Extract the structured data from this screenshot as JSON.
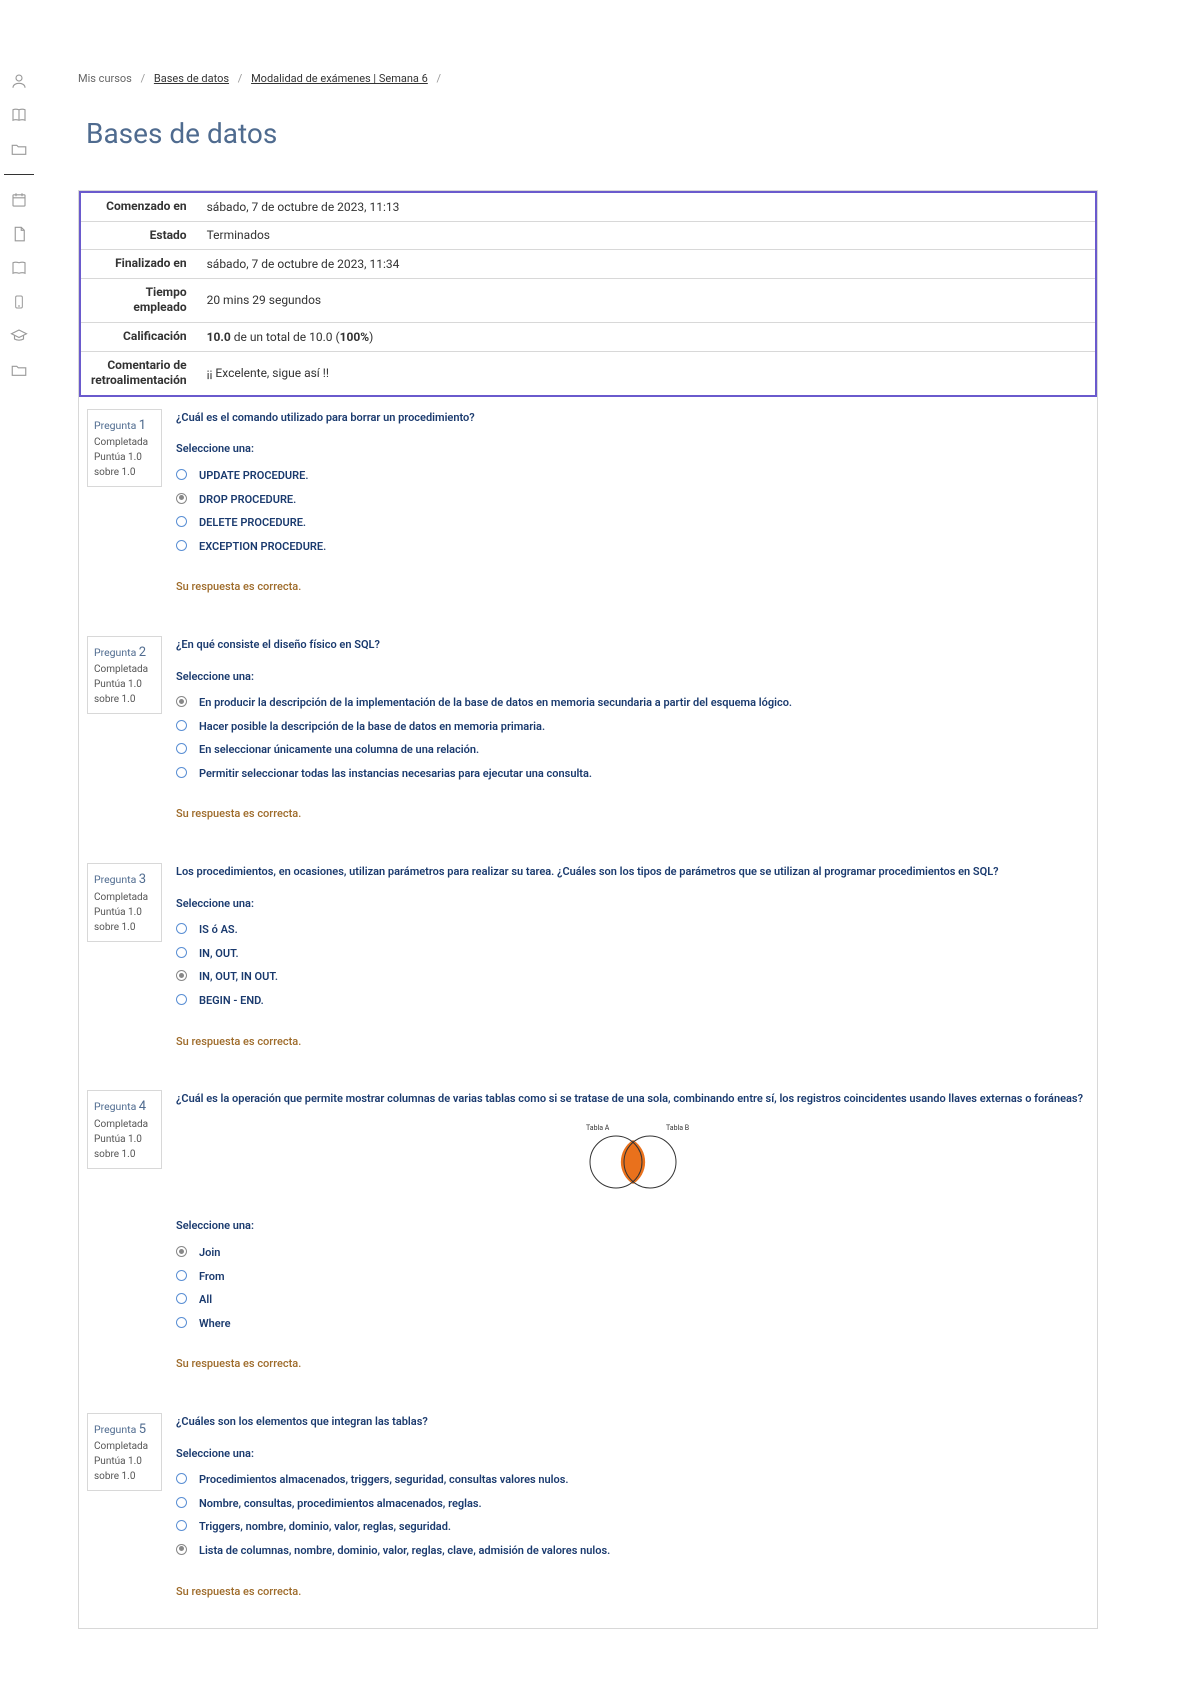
{
  "breadcrumb": {
    "item1": "Mis cursos",
    "item2": "Bases de datos",
    "item3": "Modalidad de exámenes | Semana 6"
  },
  "page_title": "Bases de datos",
  "summary": {
    "rows": [
      {
        "label": "Comenzado en",
        "value": "sábado, 7 de octubre de 2023, 11:13"
      },
      {
        "label": "Estado",
        "value": "Terminados"
      },
      {
        "label": "Finalizado en",
        "value": "sábado, 7 de octubre de 2023, 11:34"
      },
      {
        "label": "Tiempo empleado",
        "value": "20 mins 29 segundos"
      },
      {
        "label": "Calificación",
        "value_html": "10.0 de un total de 10.0 (100%)",
        "bold_prefix": "10.0",
        "rest": " de un total de 10.0 (",
        "bold_suffix": "100%",
        "rest2": ")"
      },
      {
        "label": "Comentario de retroalimentación",
        "value": "¡¡ Excelente, sigue así !!"
      }
    ]
  },
  "labels": {
    "question_prefix": "Pregunta",
    "completed": "Completada",
    "score_prefix": "Puntúa 1.0 sobre 1.0",
    "select_one": "Seleccione una:",
    "feedback_correct": "Su respuesta es correcta."
  },
  "venn": {
    "left_label": "Tabla A",
    "right_label": "Tabla B"
  },
  "questions": [
    {
      "num": "1",
      "text": "¿Cuál es el comando utilizado para borrar un procedimiento?",
      "options": [
        {
          "text": "UPDATE PROCEDURE.",
          "selected": false
        },
        {
          "text": "DROP PROCEDURE.",
          "selected": true
        },
        {
          "text": "DELETE PROCEDURE.",
          "selected": false
        },
        {
          "text": "EXCEPTION PROCEDURE.",
          "selected": false
        }
      ]
    },
    {
      "num": "2",
      "text": "¿En qué consiste el diseño físico en SQL?",
      "options": [
        {
          "text": "En producir la descripción de la implementación de la base de datos en memoria secundaria a partir del esquema lógico.",
          "selected": true
        },
        {
          "text": "Hacer posible la descripción de la base de datos en memoria primaria.",
          "selected": false
        },
        {
          "text": "En seleccionar únicamente una columna de una relación.",
          "selected": false
        },
        {
          "text": "Permitir seleccionar todas las instancias necesarias para ejecutar una consulta.",
          "selected": false
        }
      ]
    },
    {
      "num": "3",
      "text": "Los procedimientos, en ocasiones, utilizan parámetros para realizar su tarea. ¿Cuáles son los tipos de parámetros que se utilizan al programar procedimientos en SQL?",
      "options": [
        {
          "text": "IS ó AS.",
          "selected": false
        },
        {
          "text": "IN, OUT.",
          "selected": false
        },
        {
          "text": "IN, OUT, IN OUT.",
          "selected": true
        },
        {
          "text": "BEGIN - END.",
          "selected": false
        }
      ]
    },
    {
      "num": "4",
      "text": "¿Cuál es la operación que permite mostrar columnas de varias tablas como si se tratase de una sola, combinando entre sí, los registros coincidentes usando llaves externas o foráneas?",
      "has_venn": true,
      "options": [
        {
          "text": "Join",
          "selected": true
        },
        {
          "text": "From",
          "selected": false
        },
        {
          "text": "All",
          "selected": false
        },
        {
          "text": "Where",
          "selected": false
        }
      ]
    },
    {
      "num": "5",
      "text": "¿Cuáles son los elementos que integran las tablas?",
      "options": [
        {
          "text": "Procedimientos almacenados, triggers, seguridad, consultas valores nulos.",
          "selected": false
        },
        {
          "text": "Nombre, consultas, procedimientos almacenados, reglas.",
          "selected": false
        },
        {
          "text": "Triggers, nombre, dominio, valor, reglas, seguridad.",
          "selected": false
        },
        {
          "text": "Lista de columnas, nombre, dominio, valor, reglas, clave, admisión de valores nulos.",
          "selected": true
        }
      ]
    }
  ]
}
